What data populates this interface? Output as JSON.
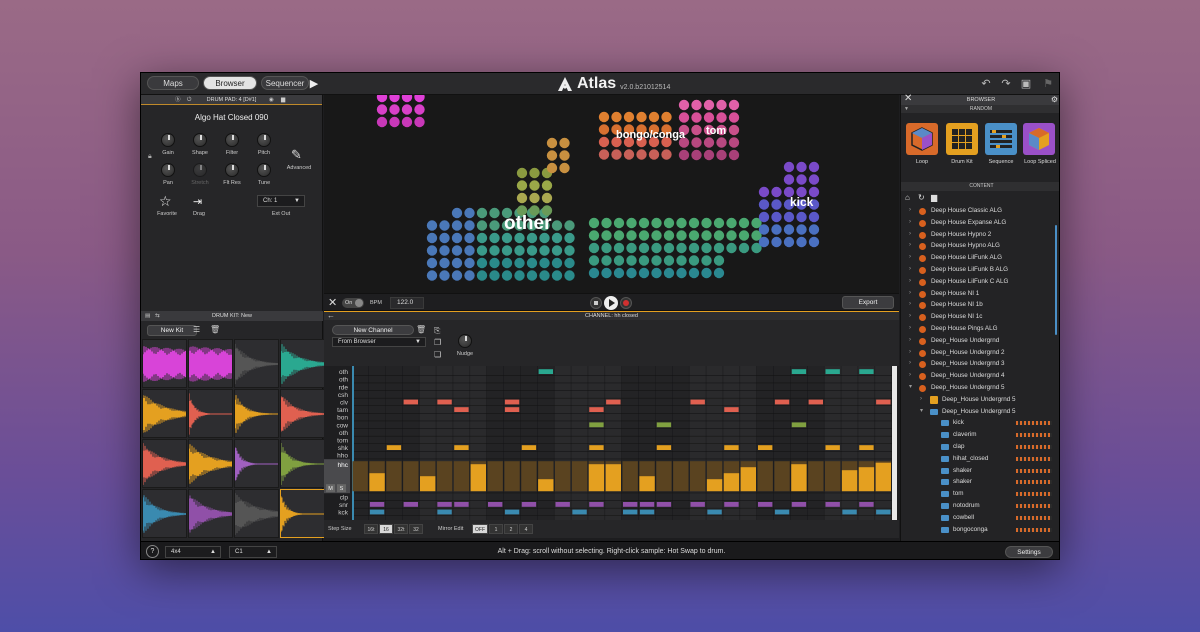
{
  "header": {
    "nav_tabs": [
      {
        "label": "Maps",
        "active": false
      },
      {
        "label": "Browser",
        "active": true
      },
      {
        "label": "Sequencer",
        "active": false
      }
    ],
    "app_name": "Atlas",
    "version": "v2.0.b21012514",
    "icons": [
      "undo-icon",
      "redo-icon",
      "save-icon",
      "flag-icon"
    ]
  },
  "drum_pad": {
    "header": "DRUM PAD: 4 [D#1]",
    "sample_name": "Algo Hat Closed 090",
    "knobs": [
      "Gain",
      "Shape",
      "Filter",
      "Pitch",
      "Pan",
      "Stretch",
      "Flt Res",
      "Tune"
    ],
    "advanced_label": "Advanced",
    "favorite_label": "Favorite",
    "drag_label": "Drag",
    "ext_out_value": "Ch: 1",
    "ext_out_label": "Ext Out"
  },
  "drum_kit": {
    "header": "DRUM KIT: New",
    "new_kit_label": "New Kit",
    "pad_colors": [
      "#d844d8",
      "#d844d8",
      "#555555",
      "#2aa890",
      "#e4a020",
      "#e06050",
      "#e4a020",
      "#e06050",
      "#e06050",
      "#e4a020",
      "#a060c0",
      "#80a040",
      "#3a8ab0",
      "#9050a8",
      "#555555",
      "#e4a020"
    ]
  },
  "viz": {
    "labels": [
      "other",
      "bongo/conga",
      "tom",
      "kick"
    ]
  },
  "transport": {
    "toggle_label": "On",
    "bpm_label": "BPM",
    "bpm_value": "122.0",
    "export_label": "Export"
  },
  "channel": {
    "header": "CHANNEL: hh closed",
    "new_channel_label": "New Channel",
    "source_value": "From Browser",
    "nudge_label": "Nudge"
  },
  "sequencer": {
    "rows": [
      "oth",
      "oth",
      "rde",
      "csh",
      "clv",
      "tam",
      "bon",
      "cow",
      "oth",
      "tom",
      "shk",
      "hho",
      "hhc",
      "clp",
      "snr",
      "kck"
    ],
    "mute_label": "M",
    "solo_label": "S"
  },
  "step_bar": {
    "step_size_label": "Step Size",
    "step_sizes": [
      "16t",
      "16",
      "32t",
      "32"
    ],
    "step_selected": "16",
    "mirror_label": "Mirror Edit",
    "mirror_options": [
      "OFF",
      "1",
      "2",
      "4"
    ],
    "mirror_selected": "OFF"
  },
  "browser": {
    "header": "BROWSER",
    "random_label": "RANDOM",
    "tiles": [
      {
        "label": "Loop",
        "color": "#d86a2a"
      },
      {
        "label": "Drum Kit",
        "color": "#e4a020"
      },
      {
        "label": "Sequence",
        "color": "#4a90c8"
      },
      {
        "label": "Loop Spliced",
        "color": "#9a50c8"
      }
    ],
    "content_label": "CONTENT",
    "folders": [
      "Deep House Classic ALG",
      "Deep House Expanse ALG",
      "Deep House Hypno 2",
      "Deep House Hypno ALG",
      "Deep House LilFunk ALG",
      "Deep House LilFunk B ALG",
      "Deep House LilFunk C ALG",
      "Deep House NI 1",
      "Deep House NI 1b",
      "Deep House NI 1c",
      "Deep House Pings ALG",
      "Deep_House Undergrnd",
      "Deep_House Undergrnd 2",
      "Deep_House Undergrnd 3",
      "Deep_House Undergrnd 4",
      "Deep_House Undergrnd 5"
    ],
    "subfolders": [
      "Deep_House Undergrnd 5",
      "Deep_House Undergrnd 5"
    ],
    "channels": [
      "kick",
      "claverim",
      "clap",
      "hihat_closed",
      "shaker",
      "shaker",
      "tom",
      "notodrum",
      "cowbell",
      "bongoconga"
    ]
  },
  "footer": {
    "help_label": "?",
    "grid_value": "4x4",
    "note_value": "C1",
    "hint": "Alt + Drag: scroll without selecting. Right-click sample: Hot Swap to drum.",
    "settings_label": "Settings"
  }
}
